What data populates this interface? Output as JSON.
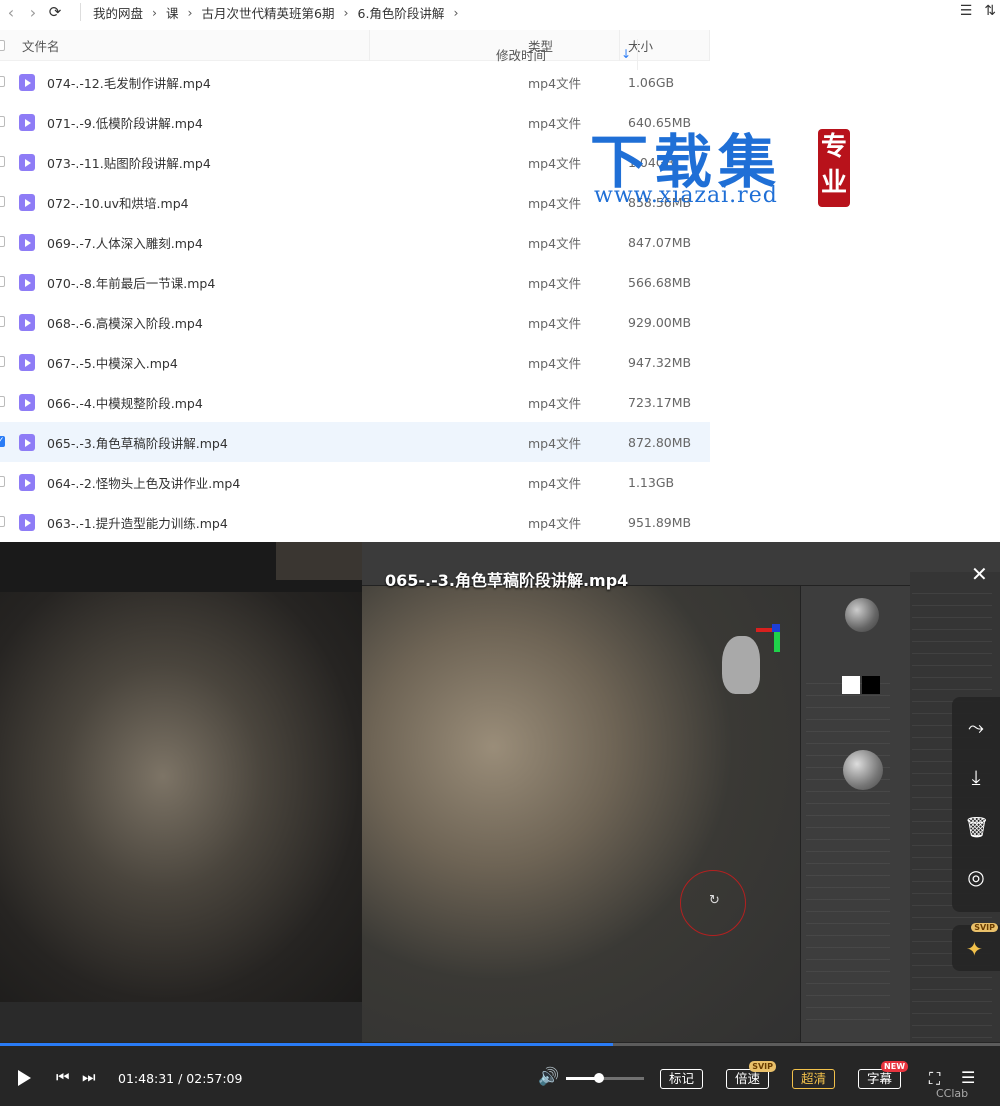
{
  "toolbar": {
    "breadcrumbs": [
      "我的网盘",
      "课",
      "古月次世代精英班第6期",
      "6.角色阶段讲解"
    ]
  },
  "columns": {
    "name": "文件名",
    "modified": "修改时间",
    "type": "类型",
    "size": "大小"
  },
  "files": [
    {
      "name": "074-.-12.毛发制作讲解.mp4",
      "type": "mp4文件",
      "size": "1.06GB",
      "selected": false
    },
    {
      "name": "071-.-9.低模阶段讲解.mp4",
      "type": "mp4文件",
      "size": "640.65MB",
      "selected": false
    },
    {
      "name": "073-.-11.贴图阶段讲解.mp4",
      "type": "mp4文件",
      "size": "1.04GB",
      "selected": false
    },
    {
      "name": "072-.-10.uv和烘培.mp4",
      "type": "mp4文件",
      "size": "858.56MB",
      "selected": false
    },
    {
      "name": "069-.-7.人体深入雕刻.mp4",
      "type": "mp4文件",
      "size": "847.07MB",
      "selected": false
    },
    {
      "name": "070-.-8.年前最后一节课.mp4",
      "type": "mp4文件",
      "size": "566.68MB",
      "selected": false
    },
    {
      "name": "068-.-6.高模深入阶段.mp4",
      "type": "mp4文件",
      "size": "929.00MB",
      "selected": false
    },
    {
      "name": "067-.-5.中模深入.mp4",
      "type": "mp4文件",
      "size": "947.32MB",
      "selected": false
    },
    {
      "name": "066-.-4.中模规整阶段.mp4",
      "type": "mp4文件",
      "size": "723.17MB",
      "selected": false
    },
    {
      "name": "065-.-3.角色草稿阶段讲解.mp4",
      "type": "mp4文件",
      "size": "872.80MB",
      "selected": true
    },
    {
      "name": "064-.-2.怪物头上色及讲作业.mp4",
      "type": "mp4文件",
      "size": "1.13GB",
      "selected": false
    },
    {
      "name": "063-.-1.提升造型能力训练.mp4",
      "type": "mp4文件",
      "size": "951.89MB",
      "selected": false
    }
  ],
  "watermark": {
    "big": "下载集",
    "url": "www.xiazai.red",
    "seal": "专业"
  },
  "player": {
    "title": "065-.-3.角色草稿阶段讲解.mp4",
    "current_time": "01:48:31",
    "duration": "02:57:09",
    "time_display": "01:48:31 / 02:57:09",
    "progress": 0.6128,
    "volume": 0.42,
    "buttons": {
      "mark": "标记",
      "speed": "倍速",
      "quality": "超清",
      "subtitle": "字幕"
    },
    "tags": {
      "speed": "SVIP",
      "subtitle": "NEW",
      "pin": "SVIP"
    },
    "brand": "CClab",
    "accent": "#2a7cf6",
    "quality_color": "#f2c14b"
  },
  "icons": {
    "back": "‹",
    "forward": "›",
    "refresh": "⟳",
    "sort": "↓",
    "close": "✕",
    "share": "⤳",
    "download": "⤓",
    "delete": "🗑",
    "eye": "◎",
    "pin": "✦",
    "prev": "⏮",
    "next": "⏭",
    "volume": "🔊",
    "fullscreen": "⛶",
    "playlist": "☰"
  }
}
